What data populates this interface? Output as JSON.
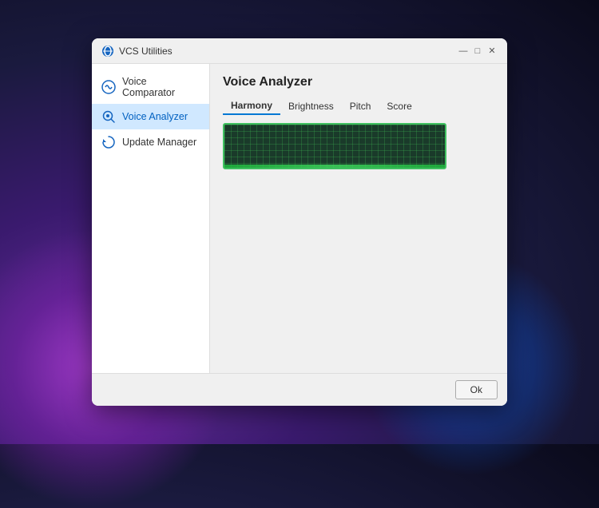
{
  "app": {
    "title": "VCS Utilities"
  },
  "titlebar": {
    "minimize_label": "—",
    "maximize_label": "□",
    "close_label": "✕"
  },
  "sidebar": {
    "items": [
      {
        "id": "voice-comparator",
        "label": "Voice Comparator",
        "active": false
      },
      {
        "id": "voice-analyzer",
        "label": "Voice Analyzer",
        "active": true
      },
      {
        "id": "update-manager",
        "label": "Update Manager",
        "active": false
      }
    ]
  },
  "main": {
    "page_title": "Voice Analyzer",
    "tabs": [
      {
        "id": "harmony",
        "label": "Harmony",
        "active": true
      },
      {
        "id": "brightness",
        "label": "Brightness",
        "active": false
      },
      {
        "id": "pitch",
        "label": "Pitch",
        "active": false
      },
      {
        "id": "score",
        "label": "Score",
        "active": false
      }
    ]
  },
  "footer": {
    "ok_label": "Ok"
  }
}
